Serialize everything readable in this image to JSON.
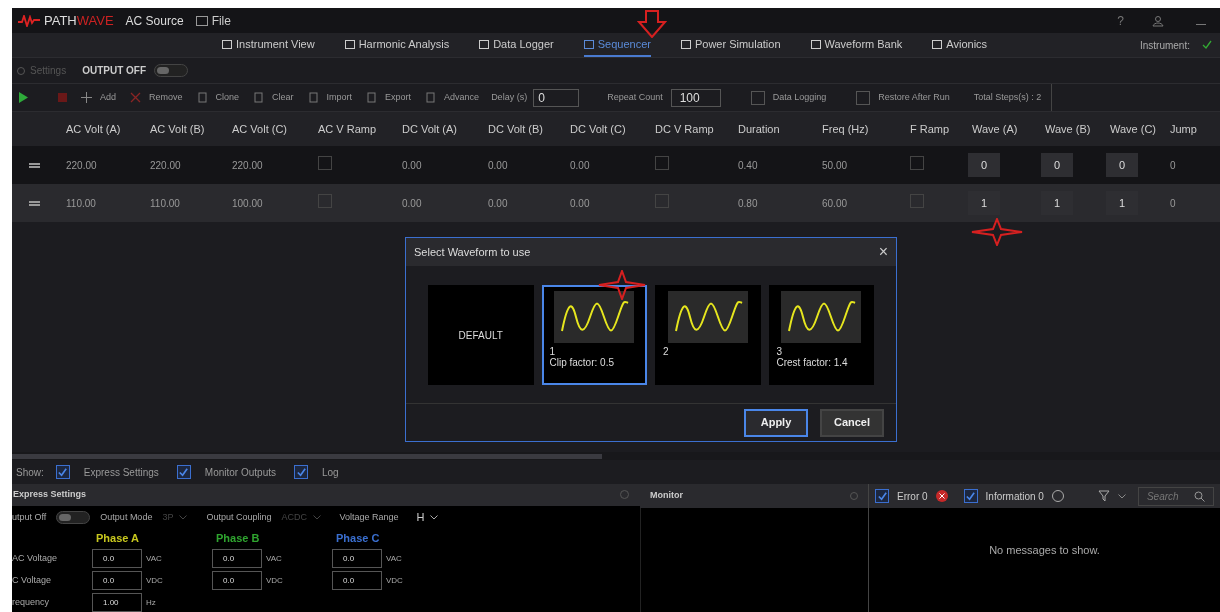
{
  "app": {
    "logo_a": "PATH",
    "logo_b": "WAVE",
    "product": "AC Source",
    "menu": "File",
    "help": "?"
  },
  "nav_tabs": [
    {
      "label": "Instrument View",
      "selected": false
    },
    {
      "label": "Harmonic Analysis",
      "selected": false
    },
    {
      "label": "Data Logger",
      "selected": false
    },
    {
      "label": "Sequencer",
      "selected": true
    },
    {
      "label": "Power Simulation",
      "selected": false
    },
    {
      "label": "Waveform Bank",
      "selected": false
    },
    {
      "label": "Avionics",
      "selected": false
    }
  ],
  "instrument_label": "Instrument:",
  "settings_bar": {
    "settings": "Settings",
    "output": "OUTPUT OFF",
    "output_on": false
  },
  "toolbar": {
    "buttons": [
      "Add",
      "Remove",
      "Clone",
      "Clear",
      "Import",
      "Export",
      "Advance"
    ],
    "delay_label": "Delay (s)",
    "delay": "0",
    "repeat_label": "Repeat Count",
    "repeat": "100",
    "checks": [
      {
        "label": "Data Logging",
        "checked": false
      },
      {
        "label": "Restore After Run",
        "checked": false
      }
    ],
    "total": "Total Steps(s) : 2"
  },
  "table": {
    "columns": [
      "AC Volt (A)",
      "AC Volt (B)",
      "AC Volt (C)",
      "AC V Ramp",
      "DC Volt (A)",
      "DC Volt (B)",
      "DC Volt (C)",
      "DC V Ramp",
      "Duration",
      "Freq (Hz)",
      "F Ramp",
      "Wave (A)",
      "Wave (B)",
      "Wave (C)",
      "Jump"
    ],
    "rows": [
      {
        "selected": false,
        "cells": [
          {
            "kind": "text",
            "value": "220.00"
          },
          {
            "kind": "text",
            "value": "220.00"
          },
          {
            "kind": "text",
            "value": "220.00"
          },
          {
            "kind": "check",
            "checked": false
          },
          {
            "kind": "text",
            "value": "0.00"
          },
          {
            "kind": "text",
            "value": "0.00"
          },
          {
            "kind": "text",
            "value": "0.00"
          },
          {
            "kind": "check",
            "checked": false
          },
          {
            "kind": "text",
            "value": "0.40"
          },
          {
            "kind": "text",
            "value": "50.00"
          },
          {
            "kind": "check",
            "checked": false
          },
          {
            "kind": "box",
            "value": "0"
          },
          {
            "kind": "box",
            "value": "0"
          },
          {
            "kind": "box",
            "value": "0"
          },
          {
            "kind": "text",
            "value": "0"
          }
        ]
      },
      {
        "selected": true,
        "cells": [
          {
            "kind": "text",
            "value": "110.00"
          },
          {
            "kind": "text",
            "value": "110.00"
          },
          {
            "kind": "text",
            "value": "100.00"
          },
          {
            "kind": "check",
            "checked": false
          },
          {
            "kind": "text",
            "value": "0.00"
          },
          {
            "kind": "text",
            "value": "0.00"
          },
          {
            "kind": "text",
            "value": "0.00"
          },
          {
            "kind": "check",
            "checked": false
          },
          {
            "kind": "text",
            "value": "0.80"
          },
          {
            "kind": "text",
            "value": "60.00"
          },
          {
            "kind": "check",
            "checked": false
          },
          {
            "kind": "box",
            "value": "1"
          },
          {
            "kind": "box",
            "value": "1"
          },
          {
            "kind": "box",
            "value": "1"
          },
          {
            "kind": "text",
            "value": "0"
          }
        ]
      }
    ]
  },
  "dialog": {
    "title": "Select Waveform to use",
    "close": "×",
    "tiles": [
      {
        "kind": "text",
        "label": "DEFAULT",
        "selected": false
      },
      {
        "kind": "wave",
        "number": "1",
        "caption": "Clip factor: 0.5",
        "selected": true
      },
      {
        "kind": "wave",
        "number": "2",
        "selected": false
      },
      {
        "kind": "wave",
        "number": "3",
        "caption": "Crest factor: 1.4",
        "selected": false
      }
    ],
    "buttons": [
      {
        "label": "Apply",
        "primary": true
      },
      {
        "label": "Cancel",
        "primary": false
      }
    ]
  },
  "show_bar": {
    "label": "Show:",
    "items": [
      {
        "label": "Express Settings",
        "checked": true
      },
      {
        "label": "Monitor Outputs",
        "checked": true
      },
      {
        "label": "Log",
        "checked": true
      }
    ]
  },
  "express": {
    "title": "Express Settings",
    "output_label": "utput Off",
    "output_on": false,
    "mode_label": "Output Mode",
    "mode": "3P",
    "coupling_label": "Output Coupling",
    "coupling": "ACDC",
    "range_label": "Voltage Range",
    "range": "H",
    "phases": [
      {
        "label": "Phase A",
        "color": "#c8c81e"
      },
      {
        "label": "Phase B",
        "color": "#2fa52f"
      },
      {
        "label": "Phase C",
        "color": "#3a6fd0"
      }
    ],
    "rows": [
      {
        "label": "AC Voltage",
        "values": [
          "0.0",
          "0.0",
          "0.0"
        ],
        "units": [
          "VAC",
          "VAC",
          "VAC"
        ]
      },
      {
        "label": "C Voltage",
        "values": [
          "0.0",
          "0.0",
          "0.0"
        ],
        "units": [
          "VDC",
          "VDC",
          "VDC"
        ]
      },
      {
        "label": "requency",
        "values": [
          "1.00"
        ],
        "units": [
          "Hz"
        ]
      }
    ]
  },
  "monitor": {
    "title": "Monitor"
  },
  "log": {
    "filters": [
      {
        "label": "Error 0",
        "kind": "error",
        "checked": true
      },
      {
        "label": "Information 0",
        "kind": "info",
        "checked": true
      }
    ],
    "search_placeholder": "Search",
    "empty": "No messages to show."
  }
}
